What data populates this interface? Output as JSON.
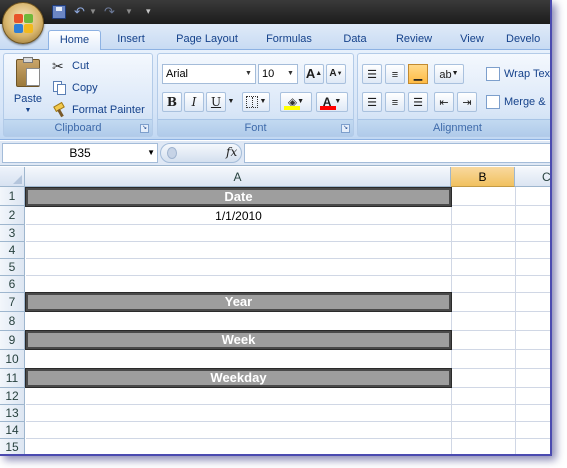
{
  "quick_access": {
    "save_icon": "save-icon",
    "undo_icon": "undo-icon",
    "redo_icon": "redo-icon",
    "customize_icon": "customize-qat-icon"
  },
  "tabs": [
    {
      "label": "Home",
      "active": true
    },
    {
      "label": "Insert"
    },
    {
      "label": "Page Layout"
    },
    {
      "label": "Formulas"
    },
    {
      "label": "Data"
    },
    {
      "label": "Review"
    },
    {
      "label": "View"
    },
    {
      "label": "Develo"
    }
  ],
  "clipboard": {
    "paste_label": "Paste",
    "cut_label": "Cut",
    "copy_label": "Copy",
    "format_painter_label": "Format Painter",
    "group_label": "Clipboard"
  },
  "font": {
    "font_name": "Arial",
    "font_size": "10",
    "bold": "B",
    "italic": "I",
    "underline": "U",
    "font_color_glyph": "A",
    "grow": "A",
    "shrink": "A",
    "group_label": "Font",
    "font_color": "#ff0000",
    "fill_color": "#ffff00"
  },
  "alignment": {
    "wrap_text_label": "Wrap Tex",
    "merge_label": "Merge &",
    "group_label": "Alignment"
  },
  "formula_bar": {
    "name_box": "B35",
    "fx_label": "fx",
    "formula": ""
  },
  "columns": [
    {
      "label": "A",
      "selected": false
    },
    {
      "label": "B",
      "selected": true
    },
    {
      "label": "C",
      "selected": false
    }
  ],
  "rows": [
    "1",
    "2",
    "3",
    "4",
    "5",
    "6",
    "7",
    "8",
    "9",
    "10",
    "11",
    "12",
    "13",
    "14",
    "15"
  ],
  "cells": {
    "A1": "Date",
    "A2": "1/1/2010",
    "A7": "Year",
    "A9": "Week",
    "A11": "Weekday"
  },
  "colors": {
    "header_fill": "#9e9e9e",
    "header_text": "#ffffff",
    "selected_column": "#f1c15f",
    "ribbon": "#d5e4f7"
  }
}
